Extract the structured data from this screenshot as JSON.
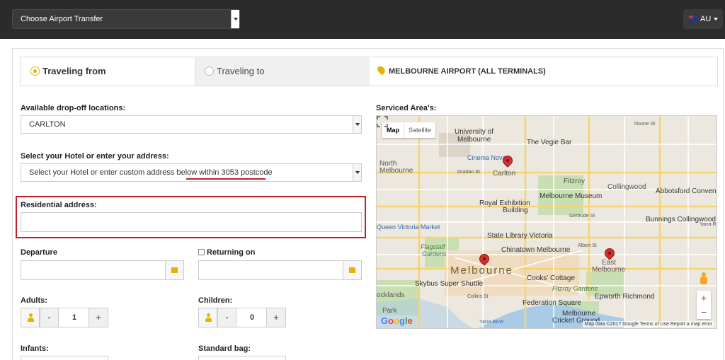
{
  "topbar": {
    "transfer_select": "Choose Airport Transfer",
    "language": "AU"
  },
  "tabs": {
    "from": "Traveling from",
    "to": "Traveling to",
    "destination": "MELBOURNE AIRPORT (ALL TERMINALS)"
  },
  "form": {
    "dropoff_label": "Available drop-off locations:",
    "dropoff_value": "CARLTON",
    "hotel_label": "Select your Hotel or enter your address:",
    "hotel_value": "Select your Hotel or enter custom address below within 3053 postcode",
    "residential_label": "Residential address:",
    "departure_label": "Departure",
    "returning_label": "Returning on",
    "adults_label": "Adults:",
    "adults_value": "1",
    "children_label": "Children:",
    "children_value": "0",
    "infants_label": "Infants:",
    "bag_label": "Standard bag:",
    "minus": "-",
    "plus": "+"
  },
  "map": {
    "title": "Serviced Area's:",
    "type_map": "Map",
    "type_satellite": "Satellite",
    "labels": {
      "university": "University of",
      "university2": "Melbourne",
      "cinema": "Cinema Nova",
      "vegie": "The Vegie Bar",
      "carlton": "Carlton",
      "north": "North",
      "melbourne_nm": "Melbourne",
      "fitzroy": "Fitzroy",
      "collingwood": "Collingwood",
      "abbotsford": "Abbotsford Convent",
      "museum": "Melbourne Museum",
      "royal": "Royal Exhibition",
      "building": "Building",
      "qvm": "Queen Victoria Market",
      "bunnings": "Bunnings Collingwood",
      "library": "State Library Victoria",
      "flagstaff": "Flagstaff",
      "gardens": "Gardens",
      "chinatown": "Chinatown Melbourne",
      "melbourne": "Melbourne",
      "east": "East",
      "east_melb": "Melbourne",
      "skybus": "Skybus Super Shuttle",
      "cooks": "Cooks' Cottage",
      "fitzroy_gardens": "Fitzroy Gardens",
      "epworth": "Epworth Richmond",
      "docklands": "ocklands",
      "park": "Park",
      "fed": "Federation Square",
      "cricket1": "Melbourne",
      "cricket2": "Cricket Ground",
      "yarra": "Yarra River",
      "noone": "Noone St",
      "albert": "Albert St",
      "gertrude": "Gertrude St",
      "grattan": "Grattan St",
      "collins": "Collins St",
      "yarra_bend": "Yarra R"
    },
    "attribution": "Map data ©2017 Google   Terms of Use   Report a map error",
    "zoom_in": "+",
    "zoom_out": "−"
  }
}
